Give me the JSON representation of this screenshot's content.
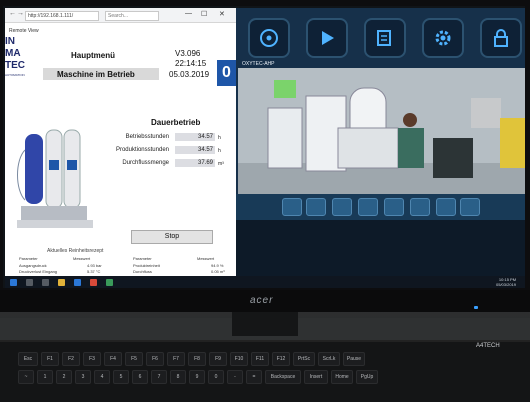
{
  "browser": {
    "address": "http://192.168.1.111/",
    "search_placeholder": "Search...",
    "tab_title": "Remote View",
    "window_controls": [
      "—",
      "☐",
      "✕"
    ]
  },
  "hmi": {
    "logo_lines": [
      "IN",
      "MA",
      "TEC"
    ],
    "logo_sub": "AUTOMATION",
    "menu_title": "Hauptmenü",
    "version": "V3.096",
    "time": "22:14:15",
    "date": "05.03.2019",
    "status": "Maschine im Betrieb",
    "badge": "0",
    "mode": "Dauerbetrieb",
    "rows": [
      {
        "label": "Betriebsstunden",
        "value": "34.57",
        "unit": "h"
      },
      {
        "label": "Produktionsstunden",
        "value": "34.57",
        "unit": "h"
      },
      {
        "label": "Durchflussmenge",
        "value": "37.69",
        "unit": "m³"
      }
    ],
    "stop_label": "Stop",
    "recipe_label": "Aktuelles Reinheitsrezept",
    "table": {
      "headers": [
        "Parameter",
        "Messwert",
        "Parameter",
        "Messwert"
      ],
      "rows": [
        [
          "Ausgangsdruck",
          "4.93 bar",
          "Produktreinheit",
          "94.9 %"
        ],
        [
          "Druckverlust Eingang",
          "5.37 °C",
          "Durchfluss",
          "0.05 m³"
        ]
      ]
    }
  },
  "camera": {
    "label": "OXYTEC-AHP",
    "top_icons": [
      "camera-reel-icon",
      "play-icon",
      "notes-icon",
      "settings-icon",
      "lock-icon"
    ],
    "control_icons": [
      "volume-icon",
      "snapshot-icon",
      "record-icon",
      "zoom-icon",
      "fullscreen-icon",
      "layout-1-icon",
      "layout-2-icon",
      "layout-4-icon"
    ]
  },
  "taskbar": {
    "time": "10:15 PM",
    "date": "05/03/2019"
  },
  "monitor": {
    "brand": "acer"
  },
  "keyboard": {
    "brand": "A4TECH",
    "row1": [
      "Esc",
      "F1",
      "F2",
      "F3",
      "F4",
      "F5",
      "F6",
      "F7",
      "F8",
      "F9",
      "F10",
      "F11",
      "F12",
      "PrtSc",
      "ScrLk",
      "Pause"
    ],
    "row2": [
      "~",
      "1",
      "2",
      "3",
      "4",
      "5",
      "6",
      "7",
      "8",
      "9",
      "0",
      "-",
      "=",
      "Backspace",
      "Insert",
      "Home",
      "PgUp"
    ]
  },
  "colors": {
    "hmi_blue": "#1e56a8",
    "app_bg": "#16304a",
    "button_border": "#2c5270"
  }
}
